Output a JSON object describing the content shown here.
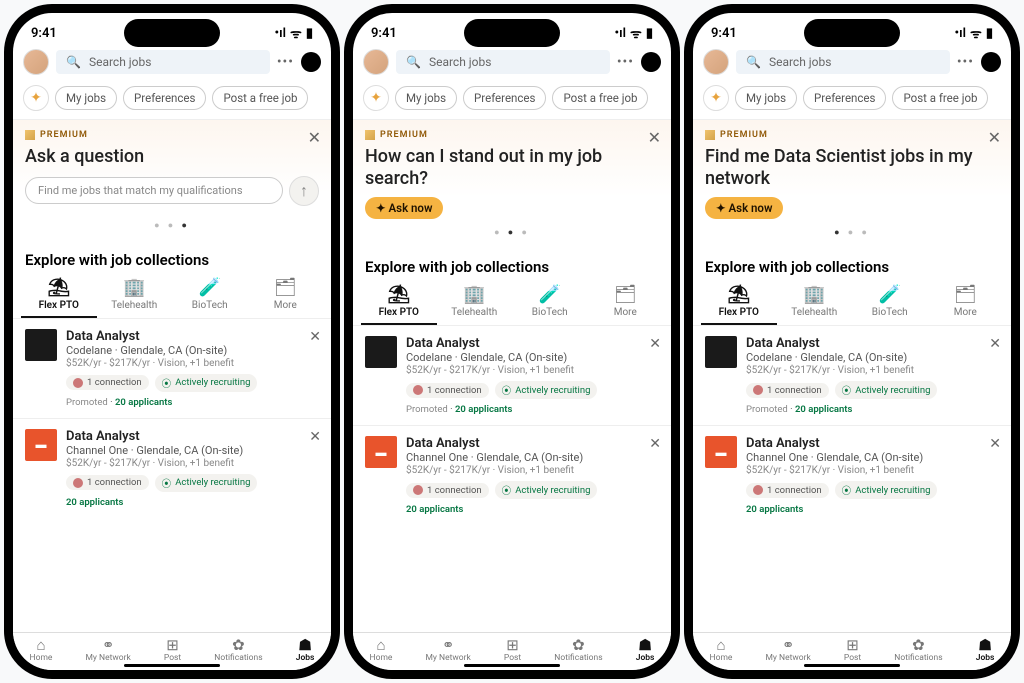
{
  "status": {
    "time": "9:41",
    "signal": "•ıl",
    "wifi": "⌄",
    "battery": "▮"
  },
  "top": {
    "search_placeholder": "Search jobs",
    "more": "•••"
  },
  "chips": {
    "myjobs": "My jobs",
    "prefs": "Preferences",
    "post": "Post a free job"
  },
  "premium_label": "PREMIUM",
  "cards": [
    {
      "title": "Ask a question",
      "input_placeholder": "Find me jobs that match my qualifications",
      "button": "",
      "mode": "input"
    },
    {
      "title": "How can I stand out in my job search?",
      "button": "✦ Ask now",
      "mode": "button"
    },
    {
      "title": "Find me Data Scientist jobs in my network",
      "button": "✦ Ask now",
      "mode": "button"
    }
  ],
  "explore_title": "Explore with job collections",
  "cols": [
    {
      "icon": "⛱",
      "label": "Flex PTO"
    },
    {
      "icon": "🏢",
      "label": "Telehealth"
    },
    {
      "icon": "🧪",
      "label": "BioTech"
    },
    {
      "icon": "🗂",
      "label": "More"
    }
  ],
  "jobs": [
    {
      "logo_text": "</>",
      "logo_class": "logo1",
      "title": "Data Analyst",
      "subtitle": "Codelane · Glendale, CA (On-site)",
      "meta": "$52K/yr - $217K/yr · Vision, +1 benefit",
      "conn": "1 connection",
      "recruit": "Actively recruiting",
      "promoted": "Promoted",
      "applicants": "20 applicants",
      "show_promoted": true
    },
    {
      "logo_text": "▬",
      "logo_class": "logo2",
      "title": "Data Analyst",
      "subtitle": "Channel One · Glendale, CA (On-site)",
      "meta": "$52K/yr - $217K/yr · Vision, +1 benefit",
      "conn": "1 connection",
      "recruit": "Actively recruiting",
      "promoted": "",
      "applicants": "20 applicants",
      "show_promoted": false
    }
  ],
  "nav": [
    {
      "icon": "⌂",
      "label": "Home"
    },
    {
      "icon": "⚭",
      "label": "My Network"
    },
    {
      "icon": "⊞",
      "label": "Post"
    },
    {
      "icon": "✿",
      "label": "Notifications"
    },
    {
      "icon": "☗",
      "label": "Jobs"
    }
  ],
  "dots": [
    [
      "○",
      "○",
      "●"
    ],
    [
      "○",
      "●",
      "○"
    ],
    [
      "●",
      "○",
      "○"
    ]
  ]
}
